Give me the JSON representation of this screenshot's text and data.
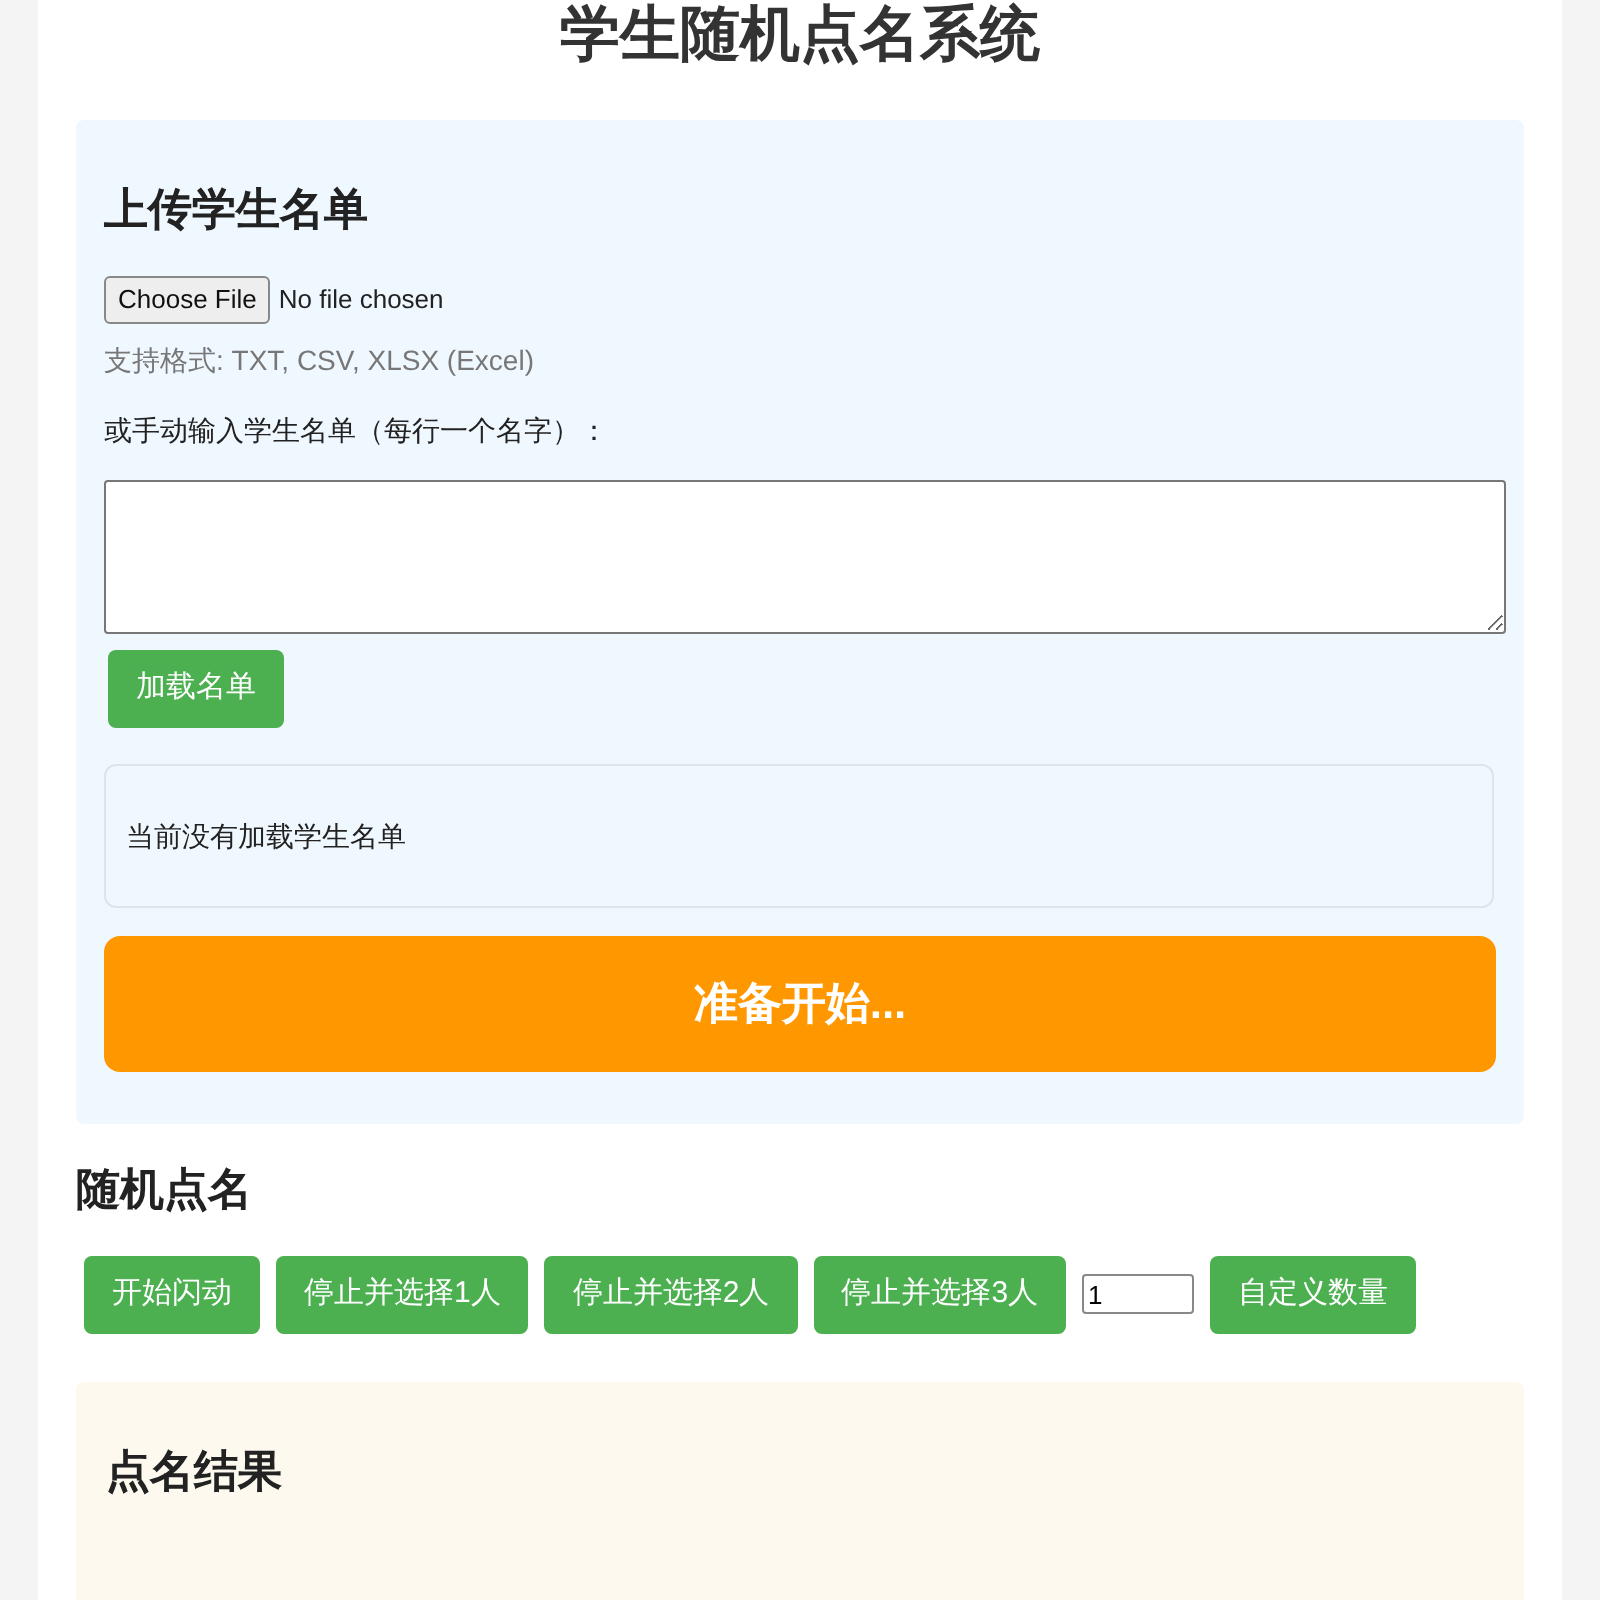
{
  "title": "学生随机点名系统",
  "upload": {
    "heading": "上传学生名单",
    "file_button": "Choose File",
    "file_status": "No file chosen",
    "hint": "支持格式: TXT, CSV, XLSX (Excel)",
    "manual_label": "或手动输入学生名单（每行一个名字）：",
    "load_button": "加载名单",
    "status": "当前没有加载学生名单",
    "display": "准备开始..."
  },
  "random": {
    "heading": "随机点名",
    "buttons": [
      {
        "label": "开始闪动"
      },
      {
        "label": "停止并选择1人"
      },
      {
        "label": "停止并选择2人"
      },
      {
        "label": "停止并选择3人"
      }
    ],
    "count_value": "1",
    "custom_button": "自定义数量"
  },
  "results": {
    "heading": "点名结果"
  }
}
